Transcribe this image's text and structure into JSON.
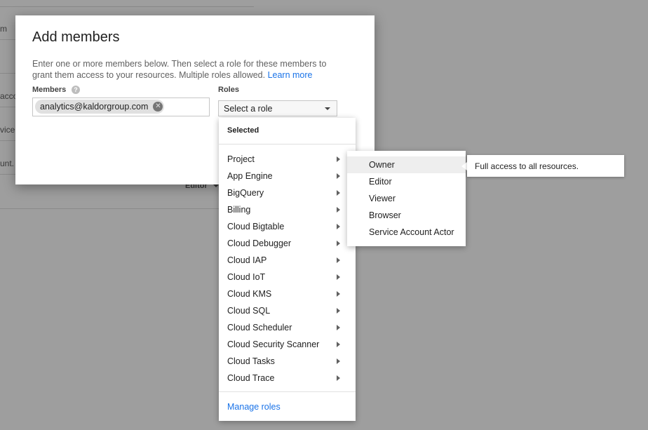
{
  "background": {
    "fragments": [
      "m",
      "acco",
      "vice",
      "unt."
    ],
    "editor_label_top": "Edit",
    "editor_label": "Editor"
  },
  "dialog": {
    "title": "Add members",
    "description": "Enter one or more members below. Then select a role for these members to grant them access to your resources. Multiple roles allowed.",
    "learn_more": "Learn more",
    "members_label": "Members",
    "help_icon_glyph": "?",
    "member_chip": "analytics@kaldorgroup.com",
    "chip_close_glyph": "✕",
    "roles_label": "Roles",
    "role_select_value": "Select a role"
  },
  "roles_menu": {
    "heading": "Selected",
    "items": [
      {
        "label": "Project"
      },
      {
        "label": "App Engine"
      },
      {
        "label": "BigQuery"
      },
      {
        "label": "Billing"
      },
      {
        "label": "Cloud Bigtable"
      },
      {
        "label": "Cloud Debugger"
      },
      {
        "label": "Cloud IAP"
      },
      {
        "label": "Cloud IoT"
      },
      {
        "label": "Cloud KMS"
      },
      {
        "label": "Cloud SQL"
      },
      {
        "label": "Cloud Scheduler"
      },
      {
        "label": "Cloud Security Scanner"
      },
      {
        "label": "Cloud Tasks"
      },
      {
        "label": "Cloud Trace"
      }
    ],
    "manage_roles": "Manage roles"
  },
  "submenu": {
    "items": [
      {
        "label": "Owner",
        "active": true
      },
      {
        "label": "Editor",
        "active": false
      },
      {
        "label": "Viewer",
        "active": false
      },
      {
        "label": "Browser",
        "active": false
      },
      {
        "label": "Service Account Actor",
        "active": false
      }
    ]
  },
  "tooltip": {
    "text": "Full access to all resources."
  }
}
